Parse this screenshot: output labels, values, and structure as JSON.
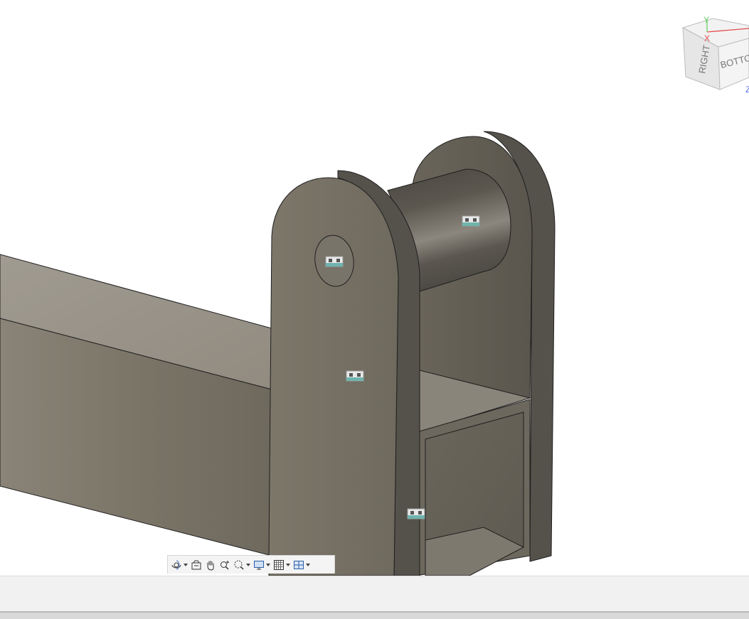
{
  "viewcube": {
    "face_right": "RIGHT",
    "face_bottom": "BOTTOM",
    "axis_y": "Y",
    "axis_x": "X",
    "axis_z": "Z"
  },
  "nav_toolbar": {
    "items": [
      {
        "name": "orbit",
        "icon": "orbit-icon",
        "has_dropdown": true
      },
      {
        "name": "look-at",
        "icon": "look-at-icon",
        "has_dropdown": false
      },
      {
        "name": "pan",
        "icon": "hand-pan-icon",
        "has_dropdown": false
      },
      {
        "name": "zoom",
        "icon": "zoom-icon",
        "has_dropdown": false
      },
      {
        "name": "fit",
        "icon": "zoom-window-icon",
        "has_dropdown": true
      },
      {
        "name": "display-settings",
        "icon": "monitor-icon",
        "has_dropdown": true
      },
      {
        "name": "grid-snaps",
        "icon": "grid-icon",
        "has_dropdown": true
      },
      {
        "name": "viewports",
        "icon": "viewports-icon",
        "has_dropdown": true
      }
    ]
  },
  "joint_glyphs": [
    "rigid-joint-1",
    "rigid-joint-2",
    "rigid-joint-3",
    "rigid-joint-4"
  ],
  "colors": {
    "model_face_light": "#8c877c",
    "model_face_mid": "#7a7467",
    "model_face_dark": "#58544d",
    "edge": "#1f1f1f",
    "timeline_bg": "#f1f1f1"
  }
}
